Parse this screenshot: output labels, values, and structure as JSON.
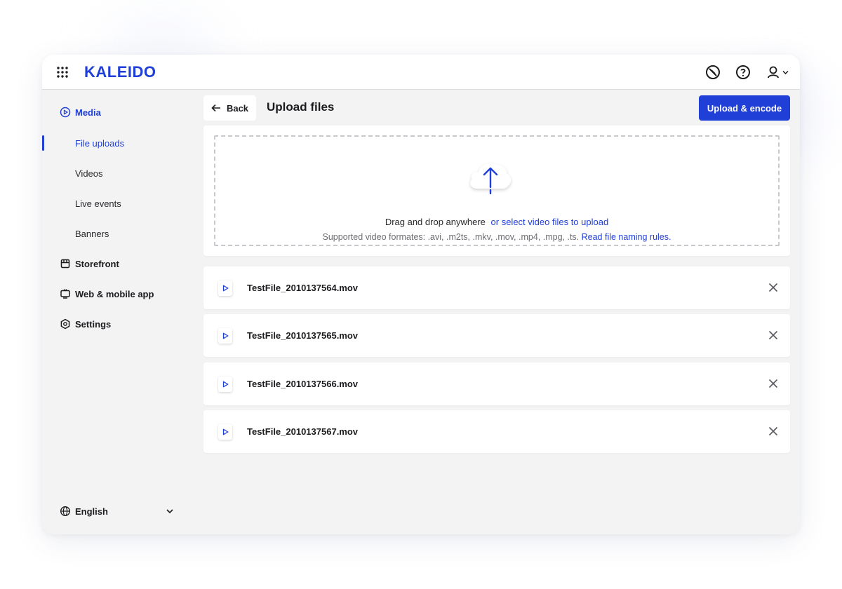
{
  "app": {
    "logo": "KALEIDO"
  },
  "topbar": {
    "icons": [
      "apps-grid-icon",
      "no-entry-icon",
      "help-icon",
      "user-icon",
      "chevron-down-icon"
    ]
  },
  "sidebar": {
    "groups": [
      {
        "label": "Media",
        "icon": "play-circle-icon"
      },
      {
        "label": "Storefront",
        "icon": "storefront-icon"
      },
      {
        "label": "Web & mobile app",
        "icon": "tv-icon"
      },
      {
        "label": "Settings",
        "icon": "gear-icon"
      }
    ],
    "media_items": [
      {
        "label": "File uploads",
        "active": true
      },
      {
        "label": "Videos"
      },
      {
        "label": "Live events"
      },
      {
        "label": "Banners"
      }
    ],
    "language": {
      "label": "English",
      "icon": "globe-icon"
    }
  },
  "header": {
    "back_label": "Back",
    "title": "Upload files",
    "primary_action": "Upload & encode"
  },
  "dropzone": {
    "text": "Drag and drop anywhere",
    "link_text": "or select video files to upload",
    "formats_text": "Supported video formates: .avi, .m2ts, .mkv, .mov, .mp4, .mpg, .ts.",
    "rules_link": "Read file naming rules."
  },
  "files": [
    {
      "name": "TestFile_2010137564.mov"
    },
    {
      "name": "TestFile_2010137565.mov"
    },
    {
      "name": "TestFile_2010137566.mov"
    },
    {
      "name": "TestFile_2010137567.mov"
    }
  ],
  "colors": {
    "accent": "#1f3fd6",
    "background": "#f3f3f4",
    "surface": "#ffffff",
    "text": "#1c1c1f",
    "muted": "#6c6c72"
  }
}
